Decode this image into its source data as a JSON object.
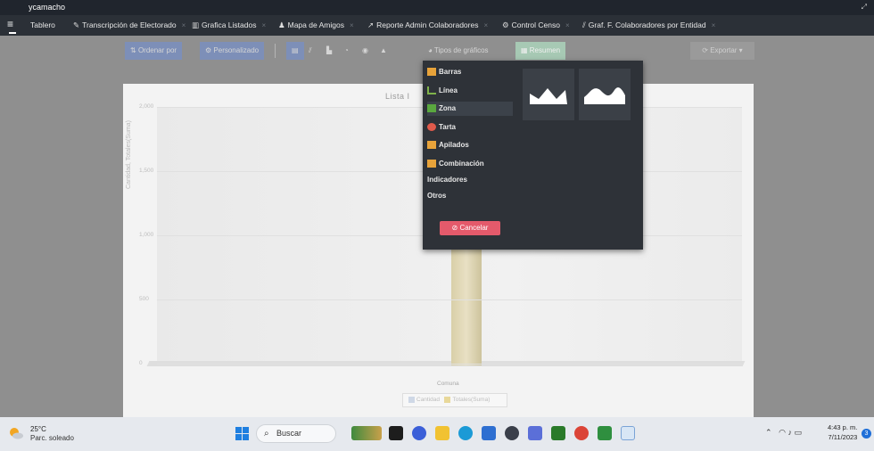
{
  "titlebar": {
    "user": "ycamacho"
  },
  "tabs": [
    {
      "label": "Tablero",
      "icon": "",
      "closable": false
    },
    {
      "label": "Transcripción de Electorado",
      "icon": "edit-icon",
      "closable": true
    },
    {
      "label": "Grafica Listados",
      "icon": "bar-chart-icon",
      "closable": true
    },
    {
      "label": "Mapa de Amigos",
      "icon": "people-icon",
      "closable": true
    },
    {
      "label": "Reporte Admin Colaboradores",
      "icon": "trend-icon",
      "closable": true
    },
    {
      "label": "Control Censo",
      "icon": "gear-icon",
      "closable": true
    },
    {
      "label": "Graf. F. Colaboradores por Entidad",
      "icon": "line-chart-icon",
      "closable": true
    }
  ],
  "toolbar": {
    "order_label": "Ordenar por",
    "custom_label": "Personalizado",
    "chart_types_label": "Tipos de gráficos",
    "summary_label": "Resumen",
    "export_label": "Exportar"
  },
  "chart": {
    "title": "Lista I",
    "y_axis_label": "Cantidad, Totales(Suma)",
    "x_category": "Comuna",
    "legend": [
      "Cantidad",
      "Totales(Suma)"
    ]
  },
  "chart_data": {
    "type": "bar",
    "title": "Lista I",
    "categories": [
      "Comuna"
    ],
    "series": [
      {
        "name": "Cantidad",
        "values": [
          0
        ]
      },
      {
        "name": "Totales(Suma)",
        "values": [
          1050
        ]
      }
    ],
    "ylabel": "Cantidad, Totales(Suma)",
    "yticks": [
      "2,000",
      "1,500",
      "1,000",
      "500",
      "0"
    ],
    "ylim": [
      0,
      2000
    ],
    "grid": true,
    "legend_position": "bottom"
  },
  "chart_type_popup": {
    "options": [
      {
        "label": "Barras",
        "color": "#e8a33a"
      },
      {
        "label": "Línea",
        "color": "#7fb24a"
      },
      {
        "label": "Zona",
        "color": "#5aa83f",
        "selected": true
      },
      {
        "label": "Tarta",
        "color": "#e05a4b"
      },
      {
        "label": "Apilados",
        "color": "#e8a33a"
      },
      {
        "label": "Combinación",
        "color": "#e8a33a"
      },
      {
        "label": "Indicadores",
        "color": ""
      },
      {
        "label": "Otros",
        "color": ""
      }
    ],
    "thumbnails": [
      "area-sharp-thumbnail",
      "area-smooth-thumbnail"
    ],
    "cancel_label": "Cancelar"
  },
  "taskbar": {
    "weather_temp": "25°C",
    "weather_desc": "Parc. soleado",
    "search_label": "Buscar",
    "time": "4:43 p. m.",
    "date": "7/11/2023",
    "notifications": "3"
  },
  "colors": {
    "accent_blue": "#7d8fb8",
    "summary_green": "#a7c9b4",
    "cancel_red": "#e45a6b",
    "bar_tan": "#e8e0c4"
  }
}
